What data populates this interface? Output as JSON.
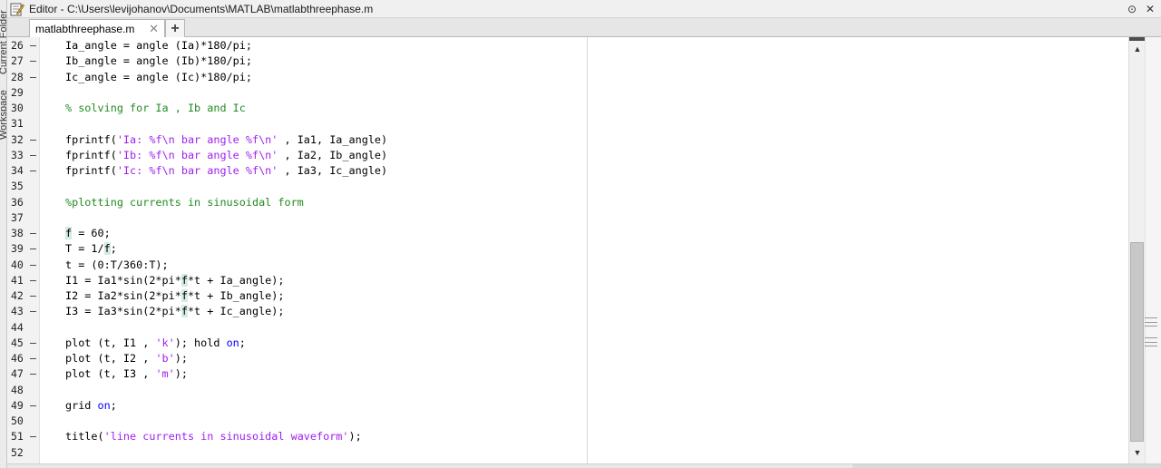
{
  "window": {
    "title": "Editor - C:\\Users\\levijohanov\\Documents\\MATLAB\\matlabthreephase.m"
  },
  "side_panel": {
    "tabs": [
      "Current Folder",
      "Workspace"
    ]
  },
  "tabs": [
    {
      "label": "matlabthreephase.m",
      "close_glyph": "✕"
    }
  ],
  "add_tab_glyph": "+",
  "title_controls": [
    "⊙",
    "✕"
  ],
  "scrollbar": {
    "up_glyph": "▲",
    "down_glyph": "▼",
    "thumb_position_fraction": 0.48
  },
  "code_lines": [
    {
      "num": "26",
      "dash": "–",
      "text": "Ia_angle = angle (Ia)*180/pi;"
    },
    {
      "num": "27",
      "dash": "–",
      "text": "Ib_angle = angle (Ib)*180/pi;"
    },
    {
      "num": "28",
      "dash": "–",
      "text": "Ic_angle = angle (Ic)*180/pi;"
    },
    {
      "num": "29",
      "dash": "",
      "text": ""
    },
    {
      "num": "30",
      "dash": "",
      "text": "% solving for Ia , Ib and Ic"
    },
    {
      "num": "31",
      "dash": "",
      "text": ""
    },
    {
      "num": "32",
      "dash": "–",
      "text": "fprintf('Ia: %f\\n bar angle %f\\n' , Ia1, Ia_angle)"
    },
    {
      "num": "33",
      "dash": "–",
      "text": "fprintf('Ib: %f\\n bar angle %f\\n' , Ia2, Ib_angle)"
    },
    {
      "num": "34",
      "dash": "–",
      "text": "fprintf('Ic: %f\\n bar angle %f\\n' , Ia3, Ic_angle)"
    },
    {
      "num": "35",
      "dash": "",
      "text": ""
    },
    {
      "num": "36",
      "dash": "",
      "text": "%plotting currents in sinusoidal form"
    },
    {
      "num": "37",
      "dash": "",
      "text": ""
    },
    {
      "num": "38",
      "dash": "–",
      "text": "f = 60;"
    },
    {
      "num": "39",
      "dash": "–",
      "text": "T = 1/f;"
    },
    {
      "num": "40",
      "dash": "–",
      "text": "t = (0:T/360:T);"
    },
    {
      "num": "41",
      "dash": "–",
      "text": "I1 = Ia1*sin(2*pi*f*t + Ia_angle);"
    },
    {
      "num": "42",
      "dash": "–",
      "text": "I2 = Ia2*sin(2*pi*f*t + Ib_angle);"
    },
    {
      "num": "43",
      "dash": "–",
      "text": "I3 = Ia3*sin(2*pi*f*t + Ic_angle);"
    },
    {
      "num": "44",
      "dash": "",
      "text": ""
    },
    {
      "num": "45",
      "dash": "–",
      "text": "plot (t, I1 , 'k'); hold on;"
    },
    {
      "num": "46",
      "dash": "–",
      "text": "plot (t, I2 , 'b');"
    },
    {
      "num": "47",
      "dash": "–",
      "text": "plot (t, I3 , 'm');"
    },
    {
      "num": "48",
      "dash": "",
      "text": ""
    },
    {
      "num": "49",
      "dash": "–",
      "text": "grid on;"
    },
    {
      "num": "50",
      "dash": "",
      "text": ""
    },
    {
      "num": "51",
      "dash": "–",
      "text": "title('line currents in sinusoidal waveform');"
    },
    {
      "num": "52",
      "dash": "",
      "text": ""
    }
  ],
  "colors": {
    "string": "#a020f0",
    "comment": "#228b22",
    "keyword": "#0000ff",
    "variable_highlight": "#d3ece3"
  },
  "highlight_variable": "f",
  "keywords": [
    "on"
  ]
}
